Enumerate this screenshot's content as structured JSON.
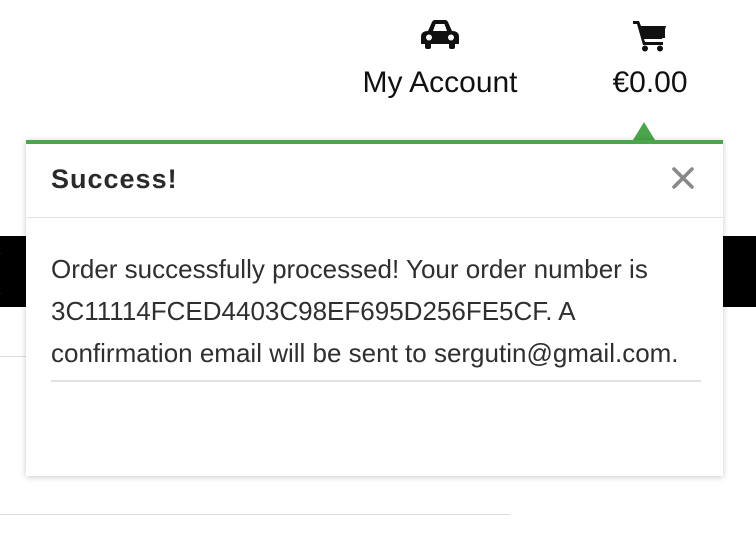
{
  "header": {
    "account": {
      "icon": "car-icon",
      "label": "My Account"
    },
    "cart": {
      "icon": "shopping-cart-icon",
      "total": "€0.00"
    }
  },
  "toast": {
    "title": "Success!",
    "message": "Order successfully processed! Your order number is 3C11114FCED4403C98EF695D256FE5CF. A confirmation email will be sent to sergutin@gmail.com.",
    "accent_color": "#4aa64a",
    "close_icon": "close-icon"
  }
}
